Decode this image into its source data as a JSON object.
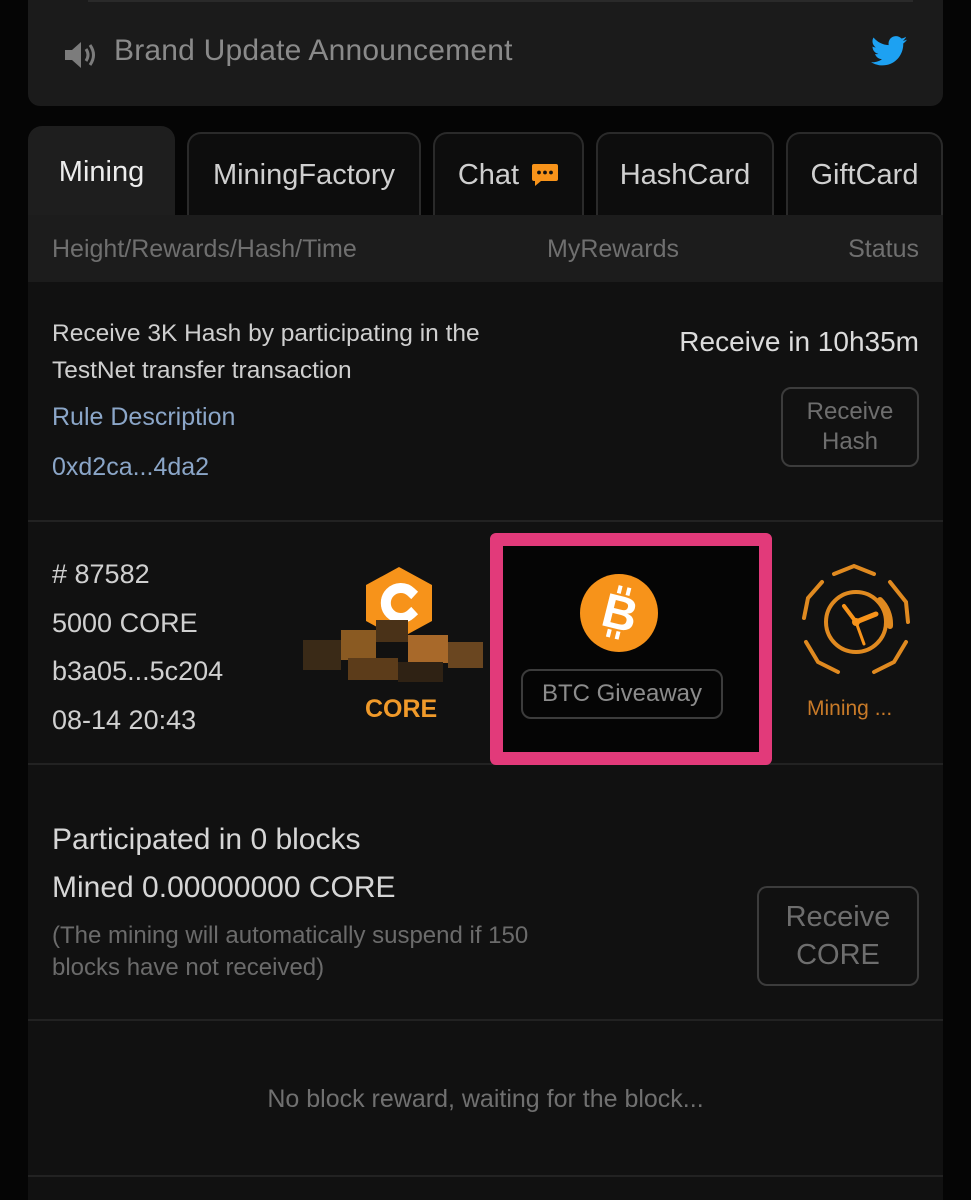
{
  "announcement": {
    "title": "Brand Update Announcement",
    "speaker_icon": "speaker-icon",
    "twitter_icon": "twitter-icon",
    "twitter_color": "#1da1f2"
  },
  "tabs": [
    {
      "label": "Mining",
      "active": true
    },
    {
      "label": "MiningFactory",
      "active": false
    },
    {
      "label": "Chat",
      "active": false,
      "icon": "chat-bubble-icon"
    },
    {
      "label": "HashCard",
      "active": false
    },
    {
      "label": "GiftCard",
      "active": false
    }
  ],
  "columns": {
    "col1": "Height/Rewards/Hash/Time",
    "col2": "MyRewards",
    "col3": "Status"
  },
  "hash_promo": {
    "description": "Receive 3K Hash by participating in the TestNet transfer transaction",
    "rule_link": "Rule Description",
    "address": "0xd2ca...4da2",
    "countdown": "Receive in 10h35m",
    "button": "Receive Hash"
  },
  "block": {
    "height": "# 87582",
    "reward": "5000 CORE",
    "hash": "b3a05...5c204",
    "time": "08-14 20:43",
    "coin_label": "CORE",
    "giveaway_button": "BTC Giveaway",
    "status": "Mining ..."
  },
  "summary": {
    "participated": "Participated in 0 blocks",
    "mined": "Mined 0.00000000 CORE",
    "note": "(The mining will automatically suspend if 150 blocks have not received)",
    "button": "Receive CORE"
  },
  "empty_message": "No block reward, waiting for the block...",
  "colors": {
    "accent_orange": "#f7931a",
    "highlight_pink": "#e23a7a",
    "link_blue": "#8ba6c8"
  }
}
